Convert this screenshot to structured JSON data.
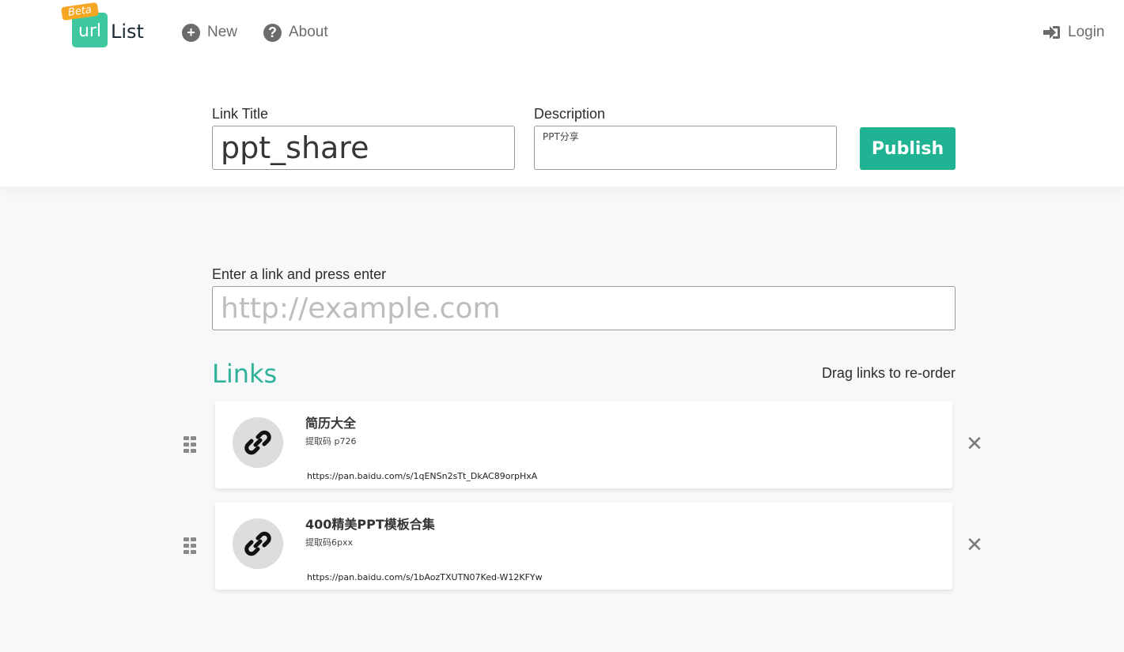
{
  "brand": {
    "badge": "Beta",
    "logo_box": "url",
    "logo_text": "List"
  },
  "nav": {
    "new_label": "New",
    "about_label": "About",
    "login_label": "Login"
  },
  "form": {
    "title_label": "Link Title",
    "title_value": "ppt_share",
    "description_label": "Description",
    "description_value": "PPT分享",
    "publish_label": "Publish"
  },
  "link_entry": {
    "label": "Enter a link and press enter",
    "placeholder": "http://example.com"
  },
  "links_section": {
    "heading": "Links",
    "hint": "Drag links to re-order"
  },
  "links": [
    {
      "title": "简历大全",
      "description": "提取码 p726",
      "url": "https://pan.baidu.com/s/1qENSn2sTt_DkAC89orpHxA"
    },
    {
      "title": "400精美PPT模板合集",
      "description": "提取码6pxx",
      "url": "https://pan.baidu.com/s/1bAozTXUTN07Ked-W12KFYw"
    }
  ],
  "colors": {
    "accent": "#1fb394",
    "heading": "#2fb19a",
    "logo": "#3fc79f",
    "badge": "#f5a623"
  },
  "icons": {
    "new": "plus-circle-icon",
    "about": "question-circle-icon",
    "login": "sign-in-icon",
    "link": "chain-link-icon",
    "drag": "grip-icon",
    "remove": "close-icon"
  }
}
